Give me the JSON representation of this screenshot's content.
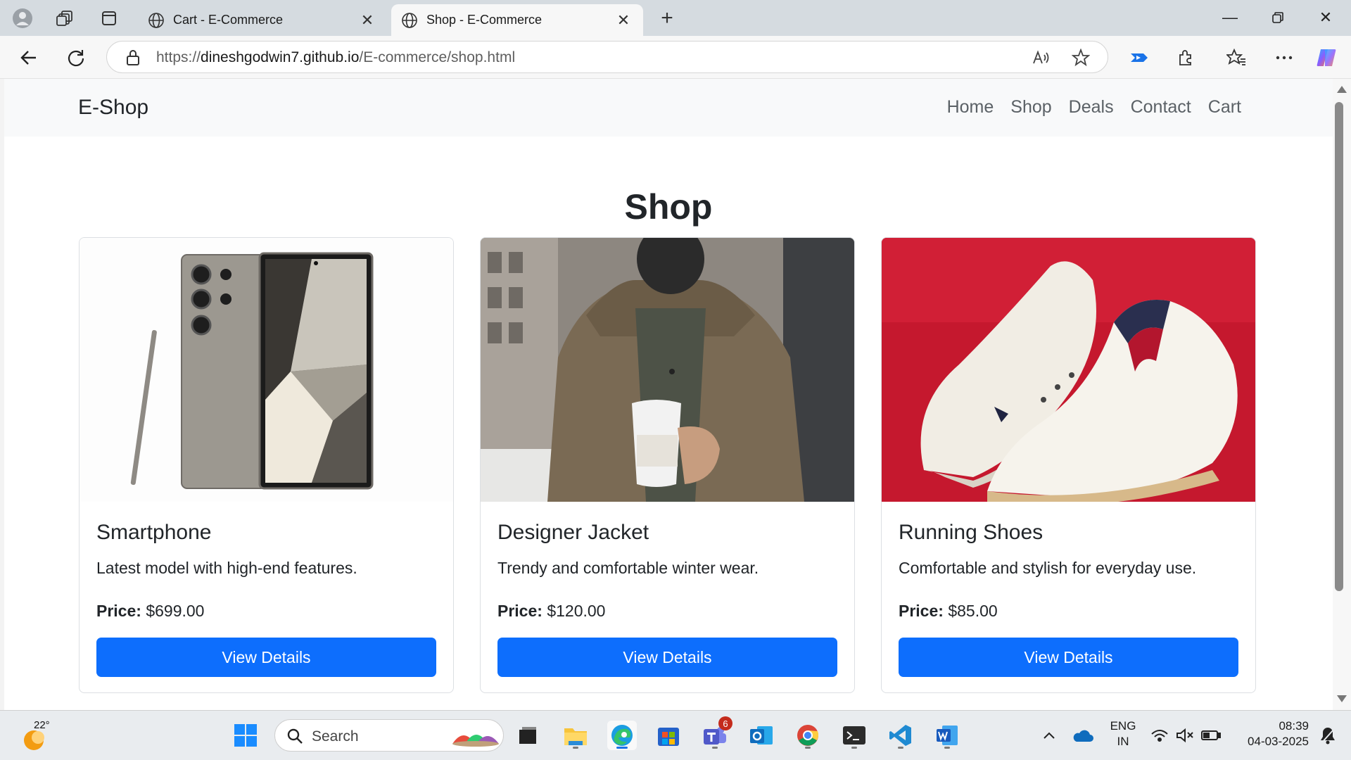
{
  "browser": {
    "tabs": [
      {
        "title": "Cart - E-Commerce",
        "active": false
      },
      {
        "title": "Shop - E-Commerce",
        "active": true
      }
    ],
    "url_prefix": "https://",
    "url_host": "dineshgodwin7.github.io",
    "url_path": "/E-commerce/shop.html"
  },
  "site": {
    "brand": "E-Shop",
    "nav": [
      "Home",
      "Shop",
      "Deals",
      "Contact",
      "Cart"
    ],
    "page_title": "Shop",
    "products": [
      {
        "name": "Smartphone",
        "description": "Latest model with high-end features.",
        "price_label": "Price:",
        "price": "$699.00",
        "button": "View Details"
      },
      {
        "name": "Designer Jacket",
        "description": "Trendy and comfortable winter wear.",
        "price_label": "Price:",
        "price": "$120.00",
        "button": "View Details"
      },
      {
        "name": "Running Shoes",
        "description": "Comfortable and stylish for everyday use.",
        "price_label": "Price:",
        "price": "$85.00",
        "button": "View Details"
      }
    ],
    "accent_color": "#0d6efd"
  },
  "taskbar": {
    "weather_temp": "22°",
    "search_placeholder": "Search",
    "teams_badge": "6",
    "language_line1": "ENG",
    "language_line2": "IN",
    "time": "08:39",
    "date": "04-03-2025"
  }
}
